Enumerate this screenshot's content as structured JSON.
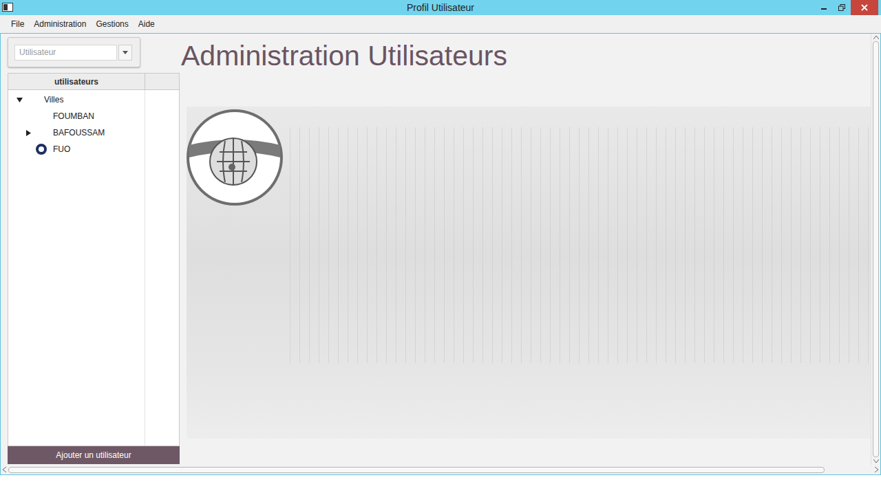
{
  "window": {
    "title": "Profil Utilisateur"
  },
  "menu": [
    "File",
    "Administration",
    "Gestions",
    "Aide"
  ],
  "user_select": {
    "placeholder": "Utilisateur"
  },
  "tree": {
    "columns": [
      "utilisateurs",
      ""
    ],
    "items": [
      {
        "label": "Villes",
        "depth": 0,
        "kind": "branch",
        "expanded": true
      },
      {
        "label": "FOUMBAN",
        "depth": 1,
        "kind": "leaf",
        "expanded": false
      },
      {
        "label": "BAFOUSSAM",
        "depth": 1,
        "kind": "branch",
        "expanded": false
      },
      {
        "label": "FUO",
        "depth": 1,
        "kind": "marked",
        "expanded": false
      }
    ]
  },
  "heading": "Administration Utilisateurs",
  "add_button": "Ajouter un utilisateur"
}
